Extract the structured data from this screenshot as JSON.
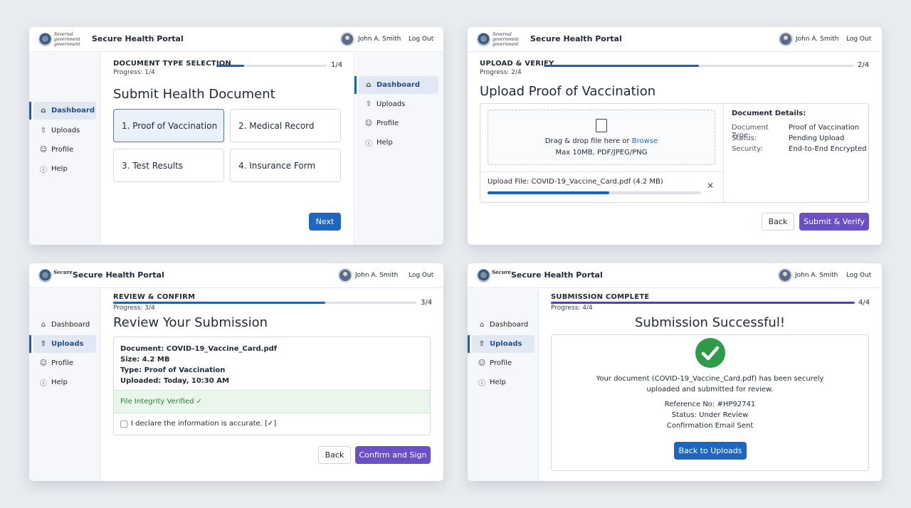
{
  "header": {
    "seal_text": [
      "Severnal",
      "government",
      "government"
    ],
    "app_title": "Secure Health Portal",
    "logo_word": "Secure",
    "user_name": "John A. Smith",
    "logout_label": "Log Out"
  },
  "sidebar": {
    "items": [
      {
        "label": "Dashboard",
        "icon": "home-icon"
      },
      {
        "label": "Uploads",
        "icon": "upload-icon"
      },
      {
        "label": "Profile",
        "icon": "user-icon"
      },
      {
        "label": "Help",
        "icon": "help-icon"
      }
    ]
  },
  "step1": {
    "step_label": "DOCUMENT TYPE SELECTION",
    "progress_text": "Progress: 1/4",
    "count": "1/4",
    "progress": 0.25,
    "title": "Submit Health Document",
    "options": [
      "1. Proof of Vaccination",
      "2. Medical Record",
      "3. Test Results",
      "4. Insurance Form"
    ],
    "next_label": "Next"
  },
  "step2": {
    "step_label": "UPLOAD & VERIFY",
    "progress_text": "Progress: 2/4",
    "count": "2/4",
    "progress": 0.5,
    "title": "Upload Proof of Vaccination",
    "drop_text": "Drag & drop file here or",
    "browse": "Browse",
    "drop_limits": "Max 10MB, PDF/JPEG/PNG",
    "upload_file_text": "Upload File: COVID-19_Vaccine_Card.pdf (4.2 MB)",
    "upload_progress": 0.57,
    "details_title": "Document Details:",
    "details": [
      {
        "key": "Document Type:",
        "value": "Proof of Vaccination"
      },
      {
        "key": "Status:",
        "value": "Pending Upload"
      },
      {
        "key": "Security:",
        "value": "End-to-End Encrypted"
      }
    ],
    "back_label": "Back",
    "submit_label": "Submit & Verify"
  },
  "step3": {
    "step_label": "REVIEW & CONFIRM",
    "progress_text": "Progress: 3/4",
    "count": "3/4",
    "progress": 0.7,
    "title": "Review Your Submission",
    "doc_lines": [
      "Document: COVID-19_Vaccine_Card.pdf",
      "Size: 4.2 MB",
      "Type: Proof of Vaccination",
      "Uploaded: Today, 10:30 AM"
    ],
    "integrity": "File Integrity Verified ✓",
    "declare": "I declare the information is accurate. [✓]",
    "back_label": "Back",
    "confirm_label": "Confirm and Sign"
  },
  "step4": {
    "step_label": "SUBMISSION COMPLETE",
    "progress_text": "Progress: 4/4",
    "count": "4/4",
    "progress": 1.0,
    "title": "Submission Successful!",
    "message_1": "Your document (COVID-19_Vaccine_Card.pdf) has been securely",
    "message_2": "uploaded and submitted for review.",
    "reference": "Reference No: #HP92741",
    "status": "Status: Under Review",
    "email": "Confirmation Email Sent",
    "back_uploads_label": "Back to Uploads"
  },
  "colors": {
    "accent_blue": "#1f66c1",
    "accent_purple": "#6a4fc6",
    "success_green": "#2f9a48"
  }
}
